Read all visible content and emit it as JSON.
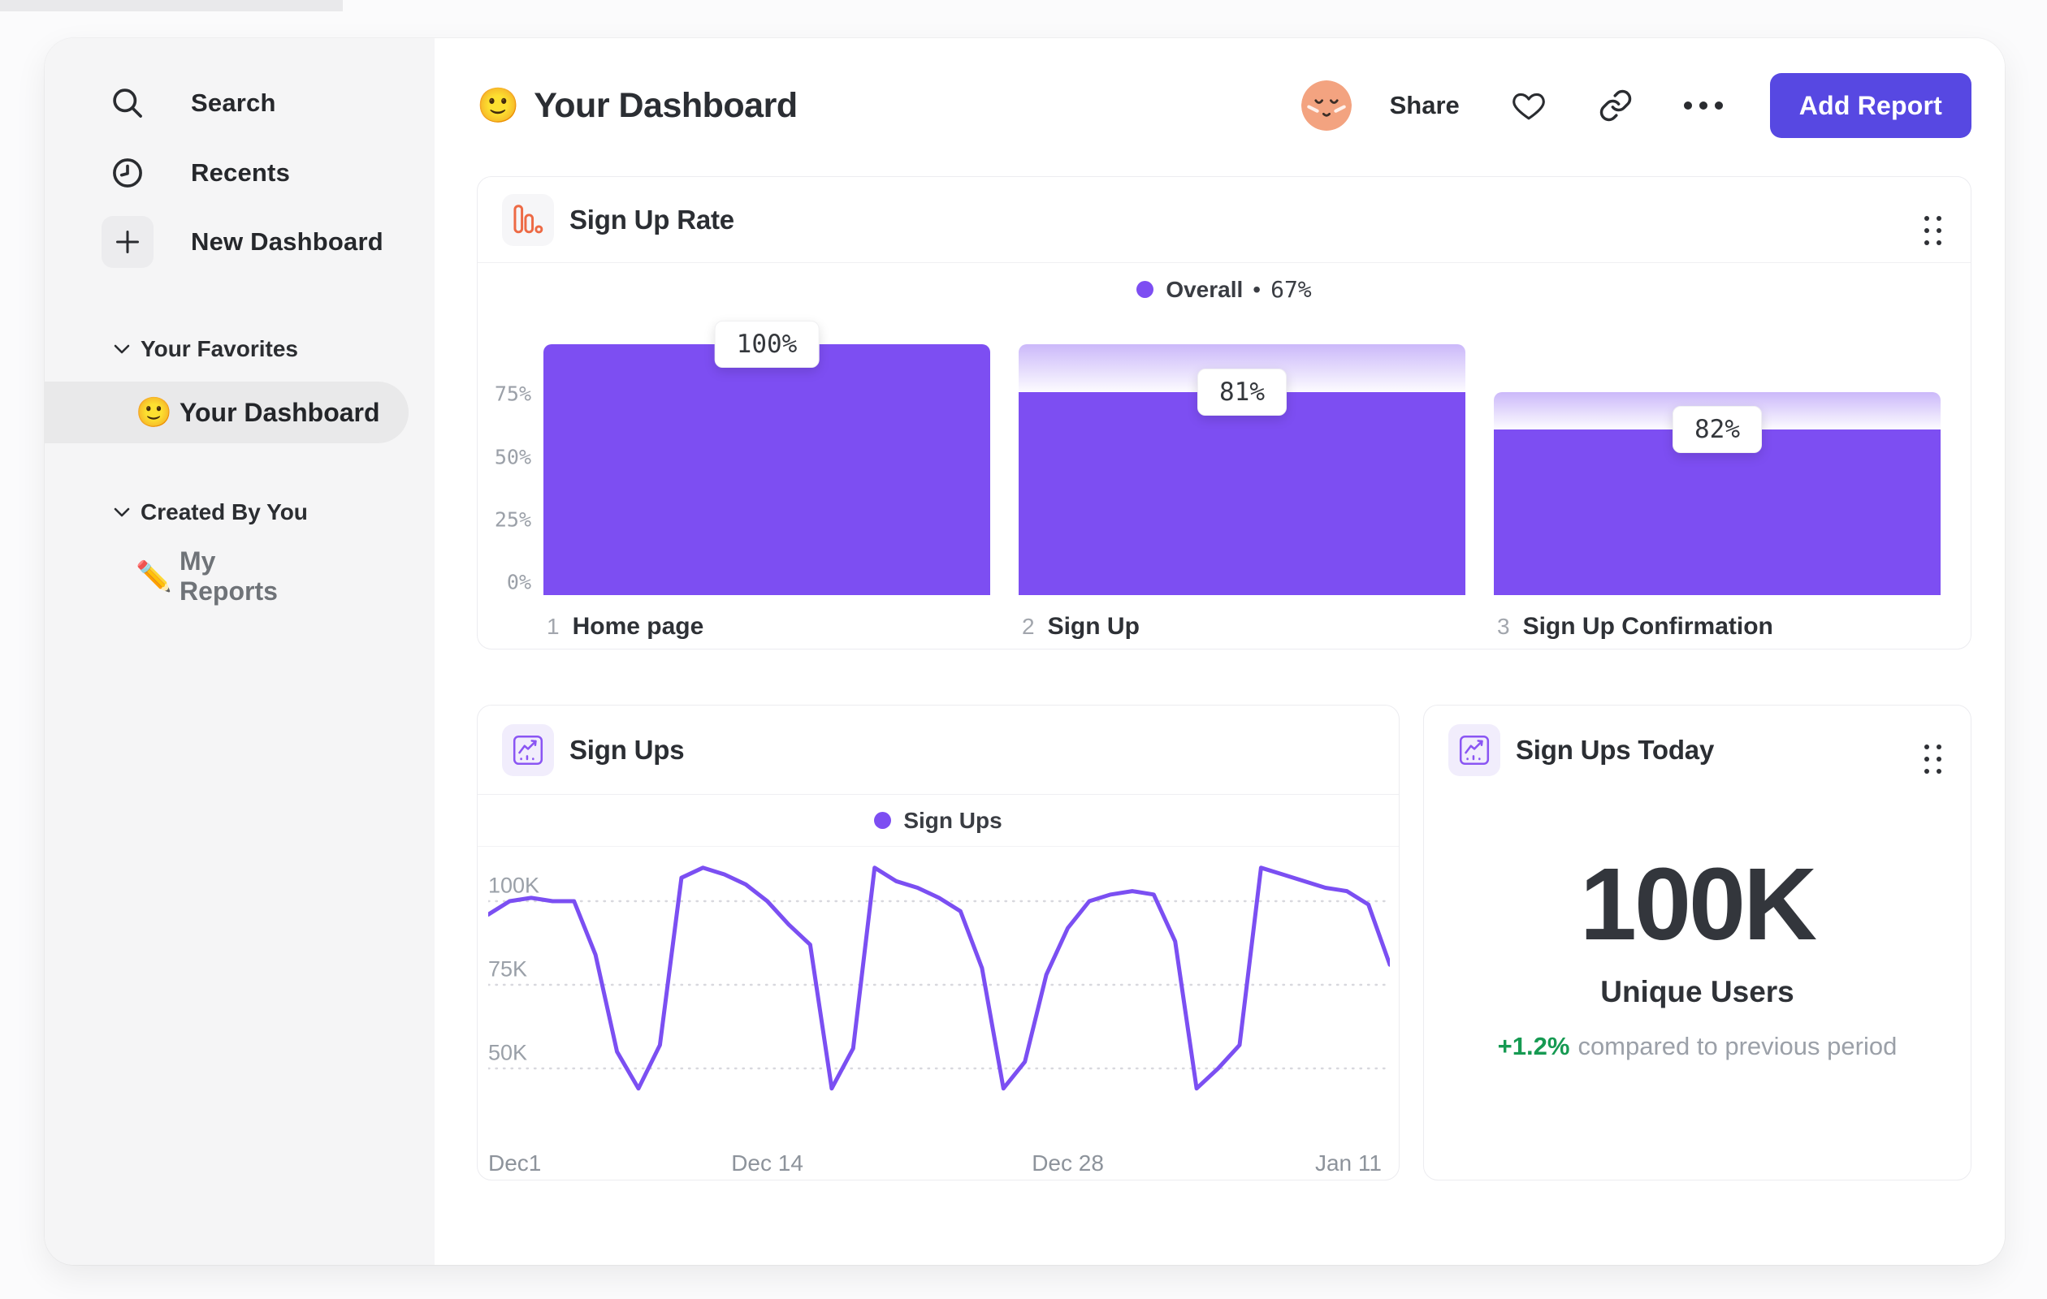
{
  "sidebar": {
    "nav": [
      {
        "icon": "search-icon",
        "label": "Search"
      },
      {
        "icon": "clock-icon",
        "label": "Recents"
      },
      {
        "icon": "plus-icon",
        "label": "New Dashboard"
      }
    ],
    "sections": [
      {
        "label": "Your Favorites",
        "items": [
          {
            "emoji": "🙂",
            "label": "Your Dashboard",
            "active": true
          }
        ]
      },
      {
        "label": "Created By You",
        "items": [
          {
            "emoji": "✏️",
            "label": "My Reports",
            "active": false
          }
        ]
      }
    ]
  },
  "header": {
    "emoji": "🙂",
    "title": "Your Dashboard",
    "share_label": "Share",
    "add_report_label": "Add Report"
  },
  "cards": {
    "funnel": {
      "title": "Sign Up Rate",
      "legend_label": "Overall",
      "legend_sep": "•",
      "legend_value": "67%"
    },
    "line": {
      "title": "Sign Ups",
      "legend_label": "Sign Ups"
    },
    "today": {
      "title": "Sign Ups Today",
      "value": "100K",
      "subtitle": "Unique Users",
      "delta": "+1.2%",
      "delta_note": "compared to previous period"
    }
  },
  "colors": {
    "accent_purple": "#7d4ef2",
    "button_indigo": "#5748e2",
    "funnel_icon_orange": "#ed6a45",
    "delta_green": "#169a52"
  },
  "chart_data": [
    {
      "type": "bar",
      "title": "Sign Up Rate",
      "subtype": "funnel",
      "categories": [
        "Home page",
        "Sign Up",
        "Sign Up Confirmation"
      ],
      "step_numbers": [
        "1",
        "2",
        "3"
      ],
      "step_labels": [
        "100%",
        "81%",
        "82%"
      ],
      "cumulative_pct": [
        100,
        81,
        66
      ],
      "overall_conversion": "67%",
      "ytick_labels": [
        "75%",
        "50%",
        "25%",
        "0%"
      ],
      "ytick_values": [
        75,
        50,
        25,
        0
      ],
      "legend": "Overall • 67%",
      "legend_position": "top-center",
      "bar_color": "#7d4ef2",
      "grid": false
    },
    {
      "type": "line",
      "title": "Sign Ups",
      "series": [
        {
          "name": "Sign Ups",
          "values_k": [
            96,
            100,
            101,
            100,
            100,
            84,
            55,
            44,
            57,
            107,
            110,
            108,
            105,
            100,
            93,
            87,
            44,
            56,
            110,
            106,
            104,
            101,
            97,
            80,
            44,
            52,
            78,
            92,
            100,
            102,
            103,
            102,
            88,
            44,
            50,
            57,
            110,
            108,
            106,
            104,
            103,
            99,
            81
          ]
        }
      ],
      "x_day_range": [
        0,
        42
      ],
      "xtick_labels": [
        "Dec1",
        "Dec 14",
        "Dec 28",
        "Jan 11"
      ],
      "xtick_days": [
        0,
        13,
        27,
        41
      ],
      "ytick_labels": [
        "100K",
        "75K",
        "50K"
      ],
      "ytick_values": [
        100,
        75,
        50
      ],
      "ylim_k": [
        38,
        116
      ],
      "grid": "dashed-horizontal",
      "legend_position": "top-center",
      "line_color": "#7b4ff2"
    }
  ]
}
